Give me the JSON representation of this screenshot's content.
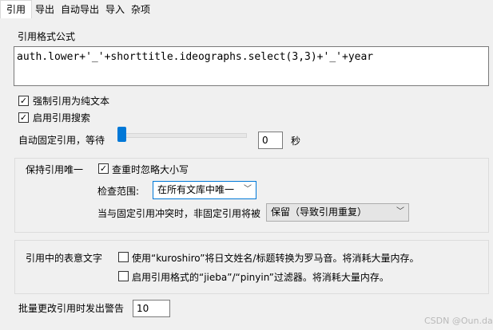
{
  "tabs": [
    {
      "label": "引用",
      "active": true
    },
    {
      "label": "导出",
      "active": false
    },
    {
      "label": "自动导出",
      "active": false
    },
    {
      "label": "导入",
      "active": false
    },
    {
      "label": "杂项",
      "active": false
    }
  ],
  "citation_format": {
    "label": "引用格式公式",
    "value": "auth.lower+'_'+shorttitle.ideographs.select(3,3)+'_'+year"
  },
  "options": {
    "force_plain_text": {
      "label": "强制引用为纯文本",
      "checked": true
    },
    "enable_search": {
      "label": "启用引用搜索",
      "checked": true
    }
  },
  "auto_pin": {
    "label": "自动固定引用，等待",
    "slider_value": 0,
    "value": "0",
    "unit": "秒"
  },
  "unique": {
    "label": "保持引用唯一",
    "ignore_case": {
      "label": "查重时忽略大小写",
      "checked": true
    },
    "scope_label": "检查范围:",
    "scope_value": "在所有文库中唯一",
    "conflict_label": "当与固定引用冲突时，非固定引用将被",
    "conflict_value": "保留（导致引用重复）"
  },
  "ideographs": {
    "label": "引用中的表意文字",
    "kuroshiro": {
      "label": "使用“kuroshiro”将日文姓名/标题转换为罗马音。将消耗大量内存。",
      "checked": false
    },
    "jieba": {
      "label": "启用引用格式的“jieba”/“pinyin”过滤器。将消耗大量内存。",
      "checked": false
    }
  },
  "bulk_warning": {
    "label": "批量更改引用时发出警告",
    "value": "10"
  },
  "watermark": "CSDN @Oun.da",
  "colors": {
    "accent": "#0078d7",
    "panel": "#f0f0f0"
  }
}
